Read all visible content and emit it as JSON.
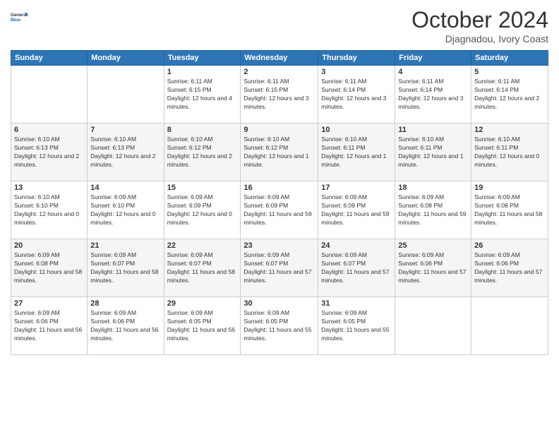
{
  "header": {
    "logo_line1": "General",
    "logo_line2": "Blue",
    "month": "October 2024",
    "location": "Djagnadou, Ivory Coast"
  },
  "days_of_week": [
    "Sunday",
    "Monday",
    "Tuesday",
    "Wednesday",
    "Thursday",
    "Friday",
    "Saturday"
  ],
  "weeks": [
    [
      {
        "day": "",
        "info": ""
      },
      {
        "day": "",
        "info": ""
      },
      {
        "day": "1",
        "info": "Sunrise: 6:11 AM\nSunset: 6:15 PM\nDaylight: 12 hours and 4 minutes."
      },
      {
        "day": "2",
        "info": "Sunrise: 6:11 AM\nSunset: 6:15 PM\nDaylight: 12 hours and 3 minutes."
      },
      {
        "day": "3",
        "info": "Sunrise: 6:11 AM\nSunset: 6:14 PM\nDaylight: 12 hours and 3 minutes."
      },
      {
        "day": "4",
        "info": "Sunrise: 6:11 AM\nSunset: 6:14 PM\nDaylight: 12 hours and 3 minutes."
      },
      {
        "day": "5",
        "info": "Sunrise: 6:11 AM\nSunset: 6:14 PM\nDaylight: 12 hours and 2 minutes."
      }
    ],
    [
      {
        "day": "6",
        "info": "Sunrise: 6:10 AM\nSunset: 6:13 PM\nDaylight: 12 hours and 2 minutes."
      },
      {
        "day": "7",
        "info": "Sunrise: 6:10 AM\nSunset: 6:13 PM\nDaylight: 12 hours and 2 minutes."
      },
      {
        "day": "8",
        "info": "Sunrise: 6:10 AM\nSunset: 6:12 PM\nDaylight: 12 hours and 2 minutes."
      },
      {
        "day": "9",
        "info": "Sunrise: 6:10 AM\nSunset: 6:12 PM\nDaylight: 12 hours and 1 minute."
      },
      {
        "day": "10",
        "info": "Sunrise: 6:10 AM\nSunset: 6:11 PM\nDaylight: 12 hours and 1 minute."
      },
      {
        "day": "11",
        "info": "Sunrise: 6:10 AM\nSunset: 6:11 PM\nDaylight: 12 hours and 1 minute."
      },
      {
        "day": "12",
        "info": "Sunrise: 6:10 AM\nSunset: 6:11 PM\nDaylight: 12 hours and 0 minutes."
      }
    ],
    [
      {
        "day": "13",
        "info": "Sunrise: 6:10 AM\nSunset: 6:10 PM\nDaylight: 12 hours and 0 minutes."
      },
      {
        "day": "14",
        "info": "Sunrise: 6:09 AM\nSunset: 6:10 PM\nDaylight: 12 hours and 0 minutes."
      },
      {
        "day": "15",
        "info": "Sunrise: 6:09 AM\nSunset: 6:09 PM\nDaylight: 12 hours and 0 minutes."
      },
      {
        "day": "16",
        "info": "Sunrise: 6:09 AM\nSunset: 6:09 PM\nDaylight: 11 hours and 59 minutes."
      },
      {
        "day": "17",
        "info": "Sunrise: 6:09 AM\nSunset: 6:09 PM\nDaylight: 11 hours and 59 minutes."
      },
      {
        "day": "18",
        "info": "Sunrise: 6:09 AM\nSunset: 6:08 PM\nDaylight: 11 hours and 59 minutes."
      },
      {
        "day": "19",
        "info": "Sunrise: 6:09 AM\nSunset: 6:08 PM\nDaylight: 11 hours and 58 minutes."
      }
    ],
    [
      {
        "day": "20",
        "info": "Sunrise: 6:09 AM\nSunset: 6:08 PM\nDaylight: 11 hours and 58 minutes."
      },
      {
        "day": "21",
        "info": "Sunrise: 6:09 AM\nSunset: 6:07 PM\nDaylight: 11 hours and 58 minutes."
      },
      {
        "day": "22",
        "info": "Sunrise: 6:09 AM\nSunset: 6:07 PM\nDaylight: 11 hours and 58 minutes."
      },
      {
        "day": "23",
        "info": "Sunrise: 6:09 AM\nSunset: 6:07 PM\nDaylight: 11 hours and 57 minutes."
      },
      {
        "day": "24",
        "info": "Sunrise: 6:09 AM\nSunset: 6:07 PM\nDaylight: 11 hours and 57 minutes."
      },
      {
        "day": "25",
        "info": "Sunrise: 6:09 AM\nSunset: 6:06 PM\nDaylight: 11 hours and 57 minutes."
      },
      {
        "day": "26",
        "info": "Sunrise: 6:09 AM\nSunset: 6:06 PM\nDaylight: 11 hours and 57 minutes."
      }
    ],
    [
      {
        "day": "27",
        "info": "Sunrise: 6:09 AM\nSunset: 6:06 PM\nDaylight: 11 hours and 56 minutes."
      },
      {
        "day": "28",
        "info": "Sunrise: 6:09 AM\nSunset: 6:06 PM\nDaylight: 11 hours and 56 minutes."
      },
      {
        "day": "29",
        "info": "Sunrise: 6:09 AM\nSunset: 6:05 PM\nDaylight: 11 hours and 56 minutes."
      },
      {
        "day": "30",
        "info": "Sunrise: 6:09 AM\nSunset: 6:05 PM\nDaylight: 11 hours and 55 minutes."
      },
      {
        "day": "31",
        "info": "Sunrise: 6:09 AM\nSunset: 6:05 PM\nDaylight: 11 hours and 55 minutes."
      },
      {
        "day": "",
        "info": ""
      },
      {
        "day": "",
        "info": ""
      }
    ]
  ]
}
